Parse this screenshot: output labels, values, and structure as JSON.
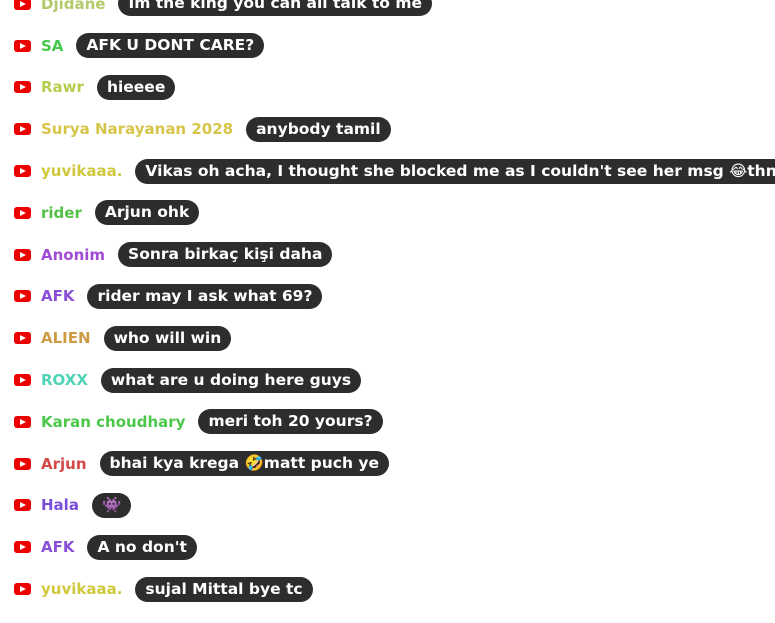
{
  "colors": {
    "youtube_icon": "#ee0000",
    "bubble_bg": "#2d2d2d",
    "bubble_text": "#ffffff"
  },
  "messages": [
    {
      "user": "Djidane",
      "user_color": "#b4c96a",
      "text": "Im the king you can all talk to me",
      "icon": "youtube-icon"
    },
    {
      "user": "SA",
      "user_color": "#45c84a",
      "text": "AFK U DONT CARE?",
      "icon": "youtube-icon"
    },
    {
      "user": "Rawr",
      "user_color": "#b4cf4e",
      "text": "hieeee",
      "icon": "youtube-icon"
    },
    {
      "user": "Surya Narayanan 2028",
      "user_color": "#d6c548",
      "text": "anybody tamil",
      "icon": "youtube-icon"
    },
    {
      "user": "yuvikaaa.",
      "user_color": "#d0c83c",
      "text": "Vikas oh acha, I thought she blocked me as I couldn't see her msg 😂thnx",
      "icon": "youtube-icon"
    },
    {
      "user": "rider",
      "user_color": "#53c148",
      "text": "Arjun ohk",
      "icon": "youtube-icon"
    },
    {
      "user": "Anonim",
      "user_color": "#a04ad6",
      "text": "Sonra birkaç kişi daha",
      "icon": "youtube-icon"
    },
    {
      "user": "AFK",
      "user_color": "#8a4fd8",
      "text": "rider may I ask what 69?",
      "icon": "youtube-icon"
    },
    {
      "user": "ALIEN",
      "user_color": "#cf9a46",
      "text": "who will win",
      "icon": "youtube-icon"
    },
    {
      "user": "ROXX",
      "user_color": "#4fd3b5",
      "text": "what are u doing here guys",
      "icon": "youtube-icon"
    },
    {
      "user": "Karan choudhary",
      "user_color": "#4bc84a",
      "text": "meri toh 20 yours?",
      "icon": "youtube-icon"
    },
    {
      "user": "Arjun",
      "user_color": "#d44848",
      "text": "bhai kya krega 🤣matt puch ye",
      "icon": "youtube-icon"
    },
    {
      "user": "Hala",
      "user_color": "#7a4fd8",
      "text": "👾",
      "icon": "youtube-icon"
    },
    {
      "user": "AFK",
      "user_color": "#8a4fd8",
      "text": "A no don't",
      "icon": "youtube-icon"
    },
    {
      "user": "yuvikaaa.",
      "user_color": "#d0c83c",
      "text": "sujal Mittal bye tc",
      "icon": "youtube-icon"
    }
  ]
}
